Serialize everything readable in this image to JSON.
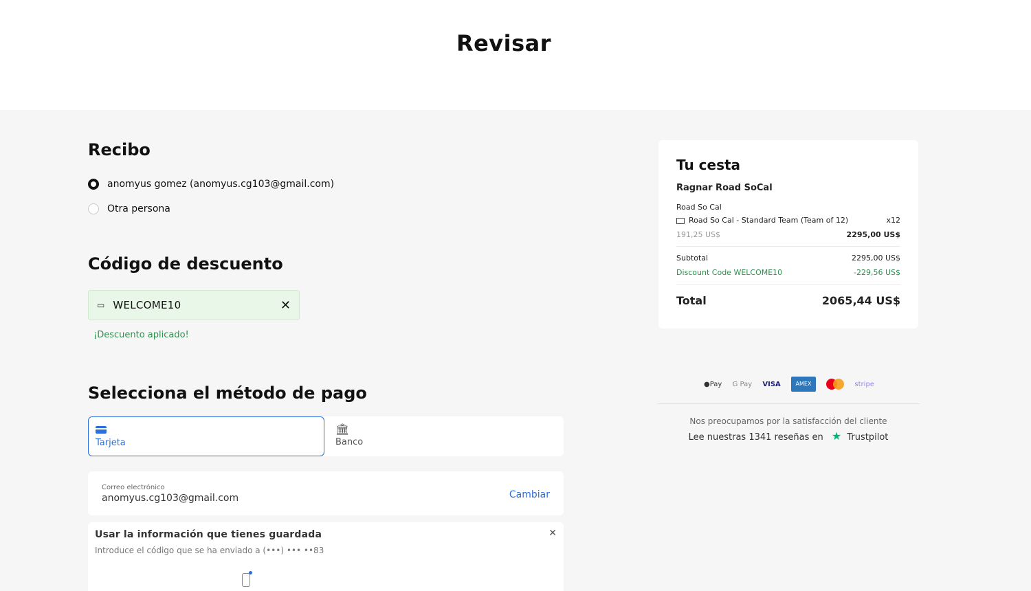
{
  "page": {
    "title": "Revisar"
  },
  "receipt": {
    "heading": "Recibo",
    "options": [
      {
        "label": "anomyus gomez (anomyus.cg103@gmail.com)",
        "selected": true
      },
      {
        "label": "Otra persona",
        "selected": false
      }
    ]
  },
  "discount": {
    "heading": "Código de descuento",
    "code": "WELCOME10",
    "status": "¡Descuento aplicado!"
  },
  "payment": {
    "heading": "Selecciona el método de pago",
    "tabs": [
      {
        "label": "Tarjeta",
        "active": true
      },
      {
        "label": "Banco",
        "active": false
      }
    ],
    "email_label": "Correo electrónico",
    "email_value": "anomyus.cg103@gmail.com",
    "change_label": "Cambiar",
    "saved_title": "Usar la información que tienes guardada",
    "saved_subtitle": "Introduce el código que se ha enviado a (•••) ••• ••83"
  },
  "basket": {
    "title": "Tu cesta",
    "event": "Ragnar Road SoCal",
    "group": "Road So Cal",
    "item": "Road So Cal - Standard Team (Team of 12)",
    "qty": "x12",
    "unit_price": "191,25 US$",
    "line_total": "2295,00 US$",
    "subtotal_label": "Subtotal",
    "subtotal_value": "2295,00 US$",
    "discount_label": "Discount Code WELCOME10",
    "discount_value": "-229,56 US$",
    "total_label": "Total",
    "total_value": "2065,44 US$"
  },
  "payment_logos": {
    "applepay": "●Pay",
    "gpay": "G Pay",
    "visa": "VISA",
    "amex": "AMEX",
    "stripe": "stripe"
  },
  "trust": {
    "line1": "Nos preocupamos por la satisfacción del cliente",
    "line2": "Lee nuestras 1341 reseñas en",
    "brand": "Trustpilot"
  },
  "colors": {
    "accent": "#2a6fdb",
    "success": "#2f8f4e",
    "background": "#f6f6f7"
  }
}
